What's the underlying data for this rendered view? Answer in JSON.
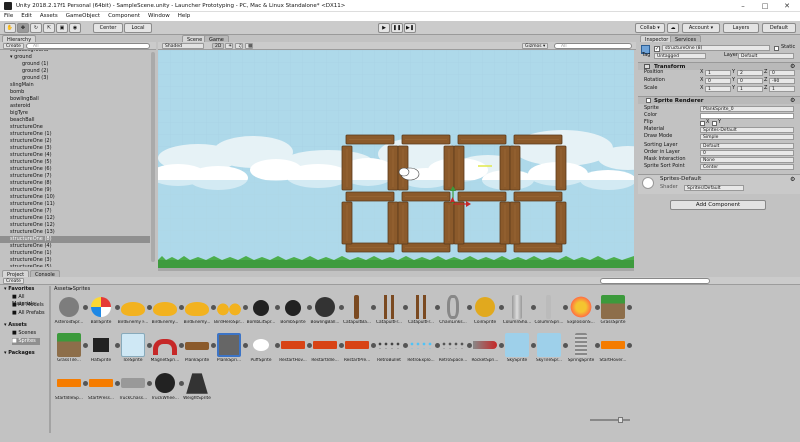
{
  "window": {
    "title": "Unity 2018.2.17f1 Personal (64bit) - SampleScene.unity - Launcher Prototyping - PC, Mac & Linux Standalone* <DX11>"
  },
  "menu": [
    "File",
    "Edit",
    "Assets",
    "GameObject",
    "Component",
    "Window",
    "Help"
  ],
  "toolbar": {
    "pivot": "Center",
    "space": "Local",
    "collab": "Collab ▾",
    "account": "Account ▾",
    "layers": "Layers",
    "layout": "Default"
  },
  "hierarchy": {
    "tab": "Hierarchy",
    "create": "Create",
    "search_placeholder": "All",
    "items": [
      {
        "label": "skyBackground",
        "indent": 0
      },
      {
        "label": "ground",
        "indent": 0,
        "expanded": true
      },
      {
        "label": "ground (1)",
        "indent": 2
      },
      {
        "label": "ground (2)",
        "indent": 2
      },
      {
        "label": "ground (3)",
        "indent": 2
      },
      {
        "label": "slingMain",
        "indent": 0
      },
      {
        "label": "bomb",
        "indent": 0
      },
      {
        "label": "bowlingBall",
        "indent": 0
      },
      {
        "label": "asteroid",
        "indent": 0
      },
      {
        "label": "bigTyre",
        "indent": 0
      },
      {
        "label": "beachBall",
        "indent": 0
      },
      {
        "label": "structureOne",
        "indent": 0
      },
      {
        "label": "structureOne (1)",
        "indent": 0
      },
      {
        "label": "structureOne (2)",
        "indent": 0
      },
      {
        "label": "structureOne (3)",
        "indent": 0
      },
      {
        "label": "structureOne (4)",
        "indent": 0
      },
      {
        "label": "structureOne (5)",
        "indent": 0
      },
      {
        "label": "structureOne (6)",
        "indent": 0
      },
      {
        "label": "structureOne (7)",
        "indent": 0
      },
      {
        "label": "structureOne (8)",
        "indent": 0
      },
      {
        "label": "structureOne (9)",
        "indent": 0
      },
      {
        "label": "structureOne (10)",
        "indent": 0
      },
      {
        "label": "structureOne (11)",
        "indent": 0
      },
      {
        "label": "structureOne (7)",
        "indent": 0
      },
      {
        "label": "structureOne (12)",
        "indent": 0
      },
      {
        "label": "structureOne (12)",
        "indent": 0
      },
      {
        "label": "structureOne (13)",
        "indent": 0
      },
      {
        "label": "structureOne (8)",
        "indent": 0,
        "selected": true
      },
      {
        "label": "structureOne (4)",
        "indent": 0
      },
      {
        "label": "structureOne (1)",
        "indent": 0
      },
      {
        "label": "structureOne (3)",
        "indent": 0
      },
      {
        "label": "structureOne (5)",
        "indent": 0
      }
    ]
  },
  "scene": {
    "tab_scene": "Scene",
    "tab_game": "Game",
    "shading": "Shaded",
    "mode": "2D",
    "gizmos": "Gizmos ▾",
    "search_placeholder": "All"
  },
  "inspector": {
    "tab": "Inspector",
    "tab2": "Services",
    "object_name": "structureOne (8)",
    "static_label": "Static",
    "tag_label": "Tag",
    "tag": "Untagged",
    "layer_label": "Layer",
    "layer": "Default",
    "transform": {
      "title": "Transform",
      "position": {
        "label": "Position",
        "x": "1",
        "y": "2",
        "z": "0"
      },
      "rotation": {
        "label": "Rotation",
        "x": "0",
        "y": "0",
        "z": "-90"
      },
      "scale": {
        "label": "Scale",
        "x": "1",
        "y": "1",
        "z": "1"
      }
    },
    "sprite_renderer": {
      "title": "Sprite Renderer",
      "sprite_label": "Sprite",
      "sprite": "PlankSprite_0",
      "color_label": "Color",
      "flip_label": "Flip",
      "flip_x": "X",
      "flip_y": "Y",
      "material_label": "Material",
      "material": "Sprites-Default",
      "draw_mode_label": "Draw Mode",
      "draw_mode": "Simple",
      "sorting_layer_label": "Sorting Layer",
      "sorting_layer": "Default",
      "order_label": "Order in Layer",
      "order": "0",
      "mask_label": "Mask Interaction",
      "mask": "None",
      "sort_point_label": "Sprite Sort Point",
      "sort_point": "Center"
    },
    "material_box": {
      "name": "Sprites-Default",
      "shader_label": "Shader",
      "shader": "Sprites/Default"
    },
    "add_component": "Add Component"
  },
  "project": {
    "tab": "Project",
    "tab2": "Console",
    "create": "Create",
    "breadcrumb": [
      "Assets",
      "Sprites"
    ],
    "tree": [
      {
        "label": "Favorites",
        "bold": true
      },
      {
        "label": "All Materials",
        "indent": 1
      },
      {
        "label": "All Models",
        "indent": 1
      },
      {
        "label": "All Prefabs",
        "indent": 1
      },
      {
        "label": "Assets",
        "bold": true
      },
      {
        "label": "Scenes",
        "indent": 1
      },
      {
        "label": "Sprites",
        "indent": 1,
        "selected": true
      },
      {
        "label": "Packages",
        "bold": true
      }
    ],
    "assets": [
      {
        "label": "AsteroidSpr...",
        "color": "#7d7d7d",
        "shape": "circle"
      },
      {
        "label": "BallSprite",
        "color": "#e7473c",
        "shape": "beachball"
      },
      {
        "label": "BirdEnemy F...",
        "color": "#f2b21f",
        "shape": "bird"
      },
      {
        "label": "BirdEnemy...",
        "color": "#f2b21f",
        "shape": "bird"
      },
      {
        "label": "BirdEnemy...",
        "color": "#f2b21f",
        "shape": "bird"
      },
      {
        "label": "BirdHeroSpr...",
        "color": "#f2b21f",
        "shape": "birds"
      },
      {
        "label": "BombLitSpr...",
        "color": "#222",
        "shape": "bomb"
      },
      {
        "label": "BombSprite",
        "color": "#222",
        "shape": "bomb"
      },
      {
        "label": "BowlingBall...",
        "color": "#333",
        "shape": "circle"
      },
      {
        "label": "CatapultBa...",
        "color": "#7b4a21",
        "shape": "stick"
      },
      {
        "label": "CatapultFr...",
        "color": "#7b4a21",
        "shape": "fork"
      },
      {
        "label": "CatapultFr...",
        "color": "#7b4a21",
        "shape": "fork"
      },
      {
        "label": "ChainLinks...",
        "color": "#888",
        "shape": "chain"
      },
      {
        "label": "CoinSprite",
        "color": "#e1a91e",
        "shape": "coin"
      },
      {
        "label": "ColumnSho...",
        "color": "#aaa",
        "shape": "column"
      },
      {
        "label": "ColumnSpri...",
        "color": "#bbb",
        "shape": "stick"
      },
      {
        "label": "ExplosionS...",
        "color": "#f4c430",
        "shape": "explosion"
      },
      {
        "label": "GrassSprite",
        "color": "#3c9a3c",
        "shape": "grass"
      },
      {
        "label": "GrassTile...",
        "color": "#3c9a3c",
        "shape": "grass"
      },
      {
        "label": "HatSprite",
        "color": "#222",
        "shape": "hat"
      },
      {
        "label": "IceSprite",
        "color": "#cfe8f5",
        "shape": "ice"
      },
      {
        "label": "MagnetSpri...",
        "color": "#c62828",
        "shape": "magnet"
      },
      {
        "label": "PlankSprite",
        "color": "#8b5a2b",
        "shape": "plank"
      },
      {
        "label": "PlankSpri...",
        "color": "#666",
        "shape": "plank2"
      },
      {
        "label": "PuffSprite",
        "color": "#fff",
        "shape": "puff"
      },
      {
        "label": "RestartHov...",
        "color": "#d84315",
        "shape": "btn"
      },
      {
        "label": "RestartIdle...",
        "color": "#d84315",
        "shape": "btn"
      },
      {
        "label": "RestartPre...",
        "color": "#d84315",
        "shape": "btn"
      },
      {
        "label": "RetroBullet",
        "color": "#444",
        "shape": "dots"
      },
      {
        "label": "RetroExplo...",
        "color": "#4fc3f7",
        "shape": "dots"
      },
      {
        "label": "RetroSpace...",
        "color": "#555",
        "shape": "dots"
      },
      {
        "label": "RocketSpri...",
        "color": "#c62828",
        "shape": "rocket"
      },
      {
        "label": "SkySprite",
        "color": "#9ed0ea",
        "shape": "sky"
      },
      {
        "label": "SkyTileSpr...",
        "color": "#9ed0ea",
        "shape": "sky"
      },
      {
        "label": "SpringSprite",
        "color": "#888",
        "shape": "spring"
      },
      {
        "label": "StartHover...",
        "color": "#f57c00",
        "shape": "btn"
      },
      {
        "label": "StartIdleSp...",
        "color": "#f57c00",
        "shape": "btn"
      },
      {
        "label": "StartPress...",
        "color": "#f57c00",
        "shape": "btn"
      },
      {
        "label": "TruckChass...",
        "color": "#888",
        "shape": "truck"
      },
      {
        "label": "TruckWhee...",
        "color": "#222",
        "shape": "wheel"
      },
      {
        "label": "WeightSprite",
        "color": "#333",
        "shape": "weight"
      }
    ]
  },
  "colors": {
    "accent": "#3c74c6",
    "wood": "#8b5a2b",
    "wood_dark": "#5a3a1c",
    "grass": "#3e9b3e",
    "sky": "#aed9ea"
  }
}
